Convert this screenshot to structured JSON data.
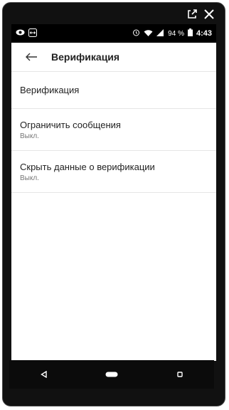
{
  "status_bar": {
    "battery": "94 %",
    "time": "4:43"
  },
  "header": {
    "title": "Верификация"
  },
  "settings": {
    "items": [
      {
        "label": "Верификация",
        "value": ""
      },
      {
        "label": "Ограничить сообщения",
        "value": "Выкл."
      },
      {
        "label": "Скрыть данные о верификации",
        "value": "Выкл."
      }
    ]
  },
  "colors": {
    "status_bar": "#000000",
    "nav_bar": "#0b0b0b",
    "divider": "#e6e6e6"
  },
  "icons": {
    "window": [
      "external-link-icon",
      "close-icon"
    ],
    "status_left": [
      "eye-icon",
      "teamviewer-icon"
    ],
    "status_right": [
      "alarm-icon",
      "wifi-icon",
      "signal-icon",
      "battery-icon"
    ],
    "nav": [
      "back-triangle-icon",
      "home-pill-icon",
      "recents-square-icon"
    ]
  }
}
